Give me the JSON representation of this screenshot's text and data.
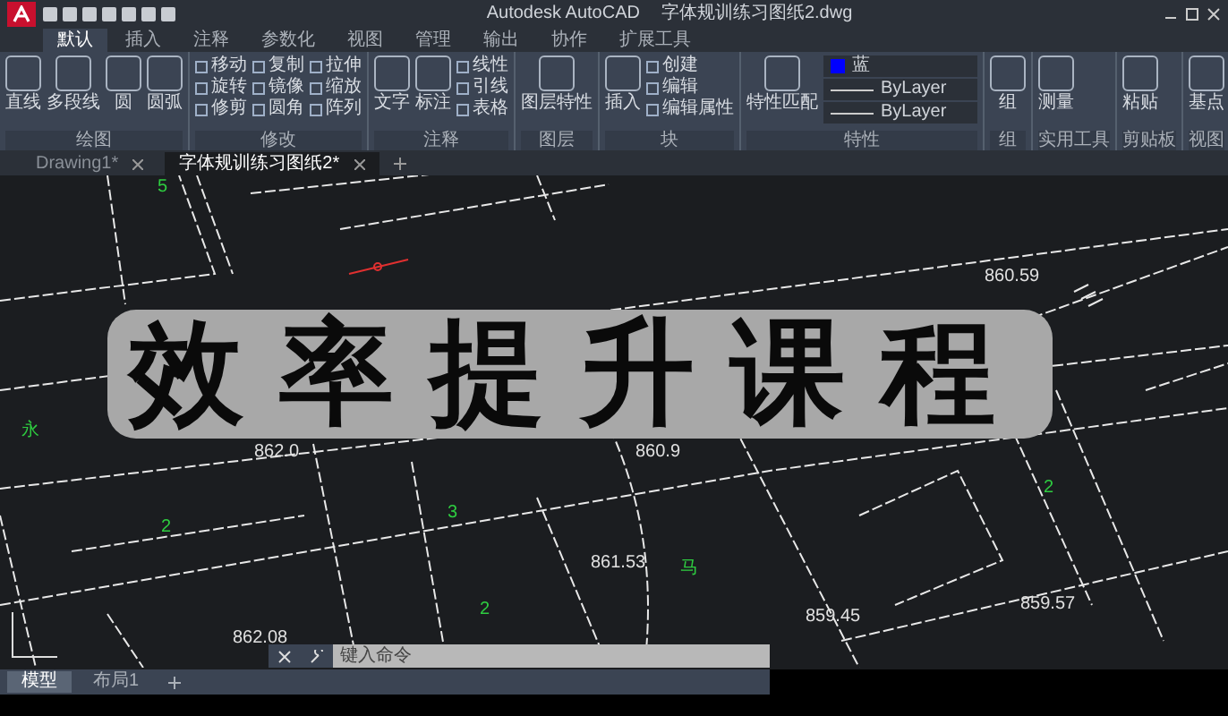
{
  "title_bar": {
    "app": "Autodesk AutoCAD",
    "file": "字体规训练习图纸2.dwg"
  },
  "ribbon_tabs": [
    {
      "label": "默认",
      "selected": true
    },
    {
      "label": "插入",
      "selected": false
    },
    {
      "label": "注释",
      "selected": false
    },
    {
      "label": "参数化",
      "selected": false
    },
    {
      "label": "视图",
      "selected": false
    },
    {
      "label": "管理",
      "selected": false
    },
    {
      "label": "输出",
      "selected": false
    },
    {
      "label": "协作",
      "selected": false
    },
    {
      "label": "扩展工具",
      "selected": false
    }
  ],
  "ribbon_panels": [
    {
      "title": "绘图",
      "large": [
        "直线",
        "多段线",
        "圆",
        "圆弧"
      ]
    },
    {
      "title": "修改",
      "small": [
        "移动",
        "旋转",
        "修剪",
        "复制",
        "镜像",
        "圆角",
        "拉伸",
        "缩放",
        "阵列"
      ]
    },
    {
      "title": "注释",
      "large": [
        "文字",
        "标注"
      ],
      "small": [
        "线性",
        "引线",
        "表格"
      ]
    },
    {
      "title": "图层",
      "large": [
        "图层特性"
      ]
    },
    {
      "title": "块",
      "large": [
        "插入"
      ],
      "small": [
        "创建",
        "编辑",
        "编辑属性"
      ]
    },
    {
      "title": "特性",
      "large": [
        "特性匹配"
      ]
    },
    {
      "title": "组",
      "large": [
        "组"
      ]
    },
    {
      "title": "实用工具",
      "large": [
        "测量"
      ]
    },
    {
      "title": "剪贴板",
      "large": [
        "粘贴"
      ]
    },
    {
      "title": "视图",
      "large": [
        "基点"
      ]
    }
  ],
  "property_dropdowns": [
    {
      "label": "蓝",
      "kind": "color",
      "color": "#0000ff"
    },
    {
      "label": "ByLayer",
      "kind": "line"
    },
    {
      "label": "ByLayer",
      "kind": "line"
    }
  ],
  "file_tabs": [
    {
      "label": "Drawing1*",
      "selected": false
    },
    {
      "label": "字体规训练习图纸2*",
      "selected": true
    }
  ],
  "drawing_labels": [
    {
      "text": "5",
      "color": "#2ecc40"
    },
    {
      "text": "862.0",
      "color": "#e0e0e0"
    },
    {
      "text": "永",
      "color": "#2ecc40"
    },
    {
      "text": "2",
      "color": "#2ecc40"
    },
    {
      "text": "3",
      "color": "#2ecc40"
    },
    {
      "text": "862.08",
      "color": "#e0e0e0"
    },
    {
      "text": "2",
      "color": "#2ecc40"
    },
    {
      "text": "860.59",
      "color": "#e0e0e0"
    },
    {
      "text": "860.9",
      "color": "#e0e0e0"
    },
    {
      "text": "861.53",
      "color": "#e0e0e0"
    },
    {
      "text": "马",
      "color": "#2ecc40"
    },
    {
      "text": "859.45",
      "color": "#e0e0e0"
    },
    {
      "text": "2",
      "color": "#2ecc40"
    },
    {
      "text": "859.57",
      "color": "#e0e0e0"
    }
  ],
  "overlay_title": "效率提升课程",
  "command_line": {
    "placeholder": "键入命令"
  },
  "layout_tabs": [
    {
      "label": "模型",
      "selected": true
    },
    {
      "label": "布局1",
      "selected": false
    }
  ]
}
